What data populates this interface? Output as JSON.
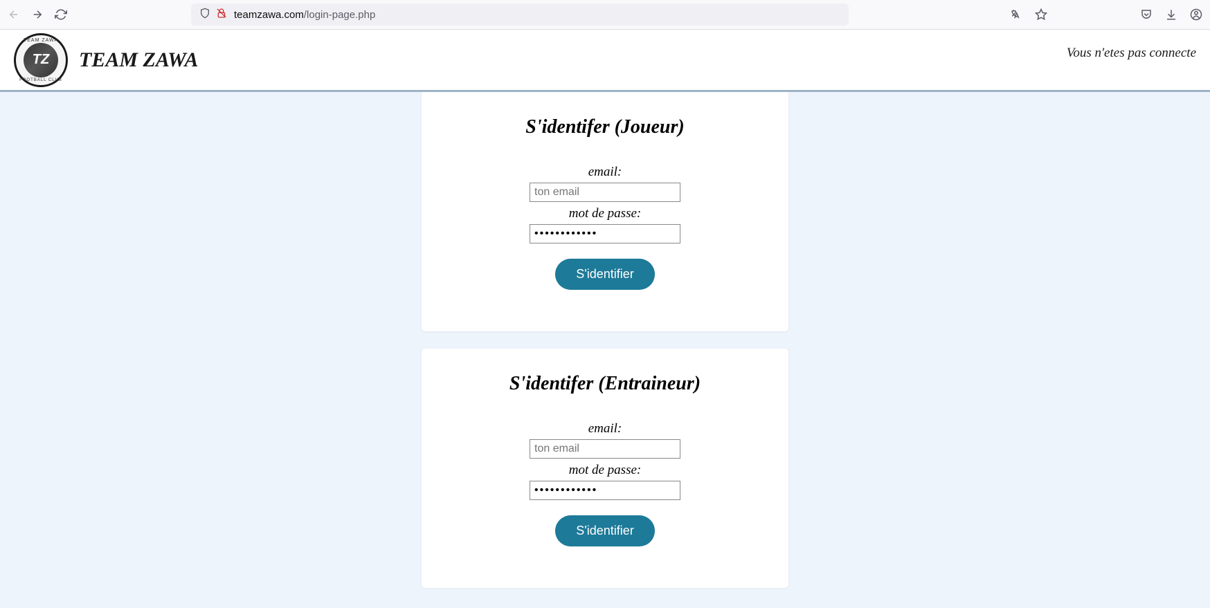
{
  "browser": {
    "url_domain": "teamzawa.com",
    "url_path": "/login-page.php"
  },
  "header": {
    "logo_tz": "TZ",
    "logo_top": "TEAM ZAWA",
    "logo_bottom": "FOOTBALL CLUB",
    "brand_first": "TEAM",
    "brand_second": " ZAWA",
    "status_text": "Vous n'etes pas connecte"
  },
  "login_player": {
    "title": "S'identifer (Joueur)",
    "email_label": "email:",
    "email_placeholder": "ton email",
    "password_label": "mot de passe:",
    "password_value": "••••••••••••",
    "submit_label": "S'identifier"
  },
  "login_coach": {
    "title": "S'identifer (Entraineur)",
    "email_label": "email:",
    "email_placeholder": "ton email",
    "password_label": "mot de passe:",
    "password_value": "••••••••••••",
    "submit_label": "S'identifier"
  }
}
